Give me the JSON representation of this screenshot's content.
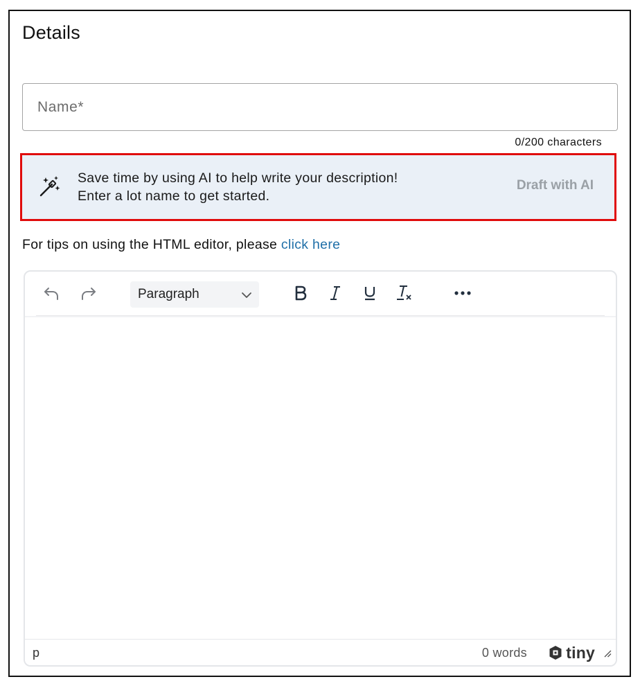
{
  "header": {
    "title": "Details"
  },
  "name_field": {
    "placeholder": "Name*",
    "value": "",
    "counter": "0/200 characters"
  },
  "ai_banner": {
    "line1": "Save time by using AI to help write your description!",
    "line2": "Enter a lot name to get started.",
    "button_label": "Draft with AI",
    "icon": "magic-wand-icon"
  },
  "tips": {
    "text": "For tips on using the HTML editor, please ",
    "link_text": "click here"
  },
  "editor": {
    "toolbar": {
      "undo_icon": "undo-icon",
      "redo_icon": "redo-icon",
      "format_value": "Paragraph",
      "bold_icon": "bold-icon",
      "italic_icon": "italic-icon",
      "underline_icon": "underline-icon",
      "clear_format_icon": "clear-formatting-icon",
      "more_icon": "more-icon"
    },
    "statusbar": {
      "path": "p",
      "wordcount": "0 words",
      "brand": "tiny"
    }
  },
  "colors": {
    "highlight_border": "#e00c0c",
    "banner_bg": "#eaf0f7",
    "link": "#1f6fa8",
    "disabled_button": "#9aa0a6"
  }
}
